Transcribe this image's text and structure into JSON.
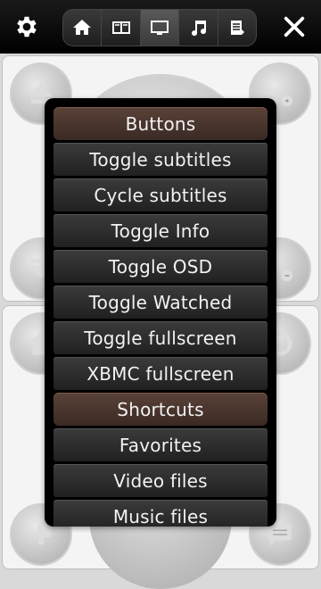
{
  "menu": {
    "items": [
      {
        "label": "Buttons",
        "type": "header"
      },
      {
        "label": "Toggle subtitles",
        "type": "item"
      },
      {
        "label": "Cycle subtitles",
        "type": "item"
      },
      {
        "label": "Toggle Info",
        "type": "item"
      },
      {
        "label": "Toggle OSD",
        "type": "item"
      },
      {
        "label": "Toggle Watched",
        "type": "item"
      },
      {
        "label": "Toggle fullscreen",
        "type": "item"
      },
      {
        "label": "XBMC fullscreen",
        "type": "item"
      },
      {
        "label": "Shortcuts",
        "type": "header"
      },
      {
        "label": "Favorites",
        "type": "item"
      },
      {
        "label": "Video files",
        "type": "item"
      },
      {
        "label": "Music files",
        "type": "item"
      }
    ]
  },
  "toolbar": {
    "tabs": [
      "home-icon",
      "columns-icon",
      "monitor-icon",
      "music-note-icon",
      "playlist-icon"
    ],
    "active_tab": "monitor-icon"
  },
  "colors": {
    "header_item": "#4a342c",
    "menu_bg": "#000000",
    "item_bg": "#2e2e2e"
  }
}
